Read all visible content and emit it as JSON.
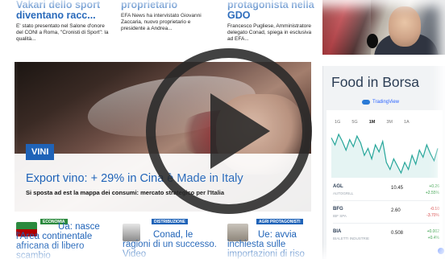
{
  "top_stories": [
    {
      "title": "Vakari dello sport diventano racc...",
      "subtitle": "E' stato presentato nel Salone d'onore del CONI a Roma, \"Cronisti di Sport\": la qualità..."
    },
    {
      "title": "proprietario",
      "subtitle": "EFA News ha intervistato Giovanni Zaccaria, nuovo proprietario e presidente a Andrea..."
    },
    {
      "title": "protagonista nella GDO",
      "subtitle": "Francesco Pugliese, Amministratore delegato Conad, spiega in esclusiva ad EFA..."
    }
  ],
  "hero": {
    "tag": "VINI",
    "headline": "Export vino: + 29% in Cina è Made in Italy",
    "dek": "Si sposta ad est la mappa dei consumi: mercato strategico per l'Italia"
  },
  "bottom_stories": [
    {
      "badge": "ECONOMIA",
      "title": "Ua: nasce l'Area continentale africana di libero scambio"
    },
    {
      "badge": "DISTRIBUZIONE",
      "title": "Conad, le ragioni di un successo. Video"
    },
    {
      "badge": "AGRI PROTAGONISTI",
      "title": "Ue: avvia inchiesta sulle importazioni di riso"
    }
  ],
  "widget": {
    "title": "Food in Borsa",
    "provider": "TradingView",
    "tabs": [
      "1G",
      "5G",
      "1M",
      "3M",
      "1A"
    ],
    "active_tab": "1M",
    "rows": [
      {
        "symbol": "AGL",
        "name": "AUTOGRILL",
        "price": "10.45",
        "change": "+0.26",
        "change_pct": "+2.55%",
        "direction": "up"
      },
      {
        "symbol": "BFG",
        "name": "IBF SPA",
        "price": "2.60",
        "change": "-0.10",
        "change_pct": "-3.70%",
        "direction": "down"
      },
      {
        "symbol": "BIA",
        "name": "BIALETTI INDUSTRIE",
        "price": "0.508",
        "change": "+0.002",
        "change_pct": "+0.4%",
        "direction": "up"
      }
    ],
    "sparkline": [
      62,
      58,
      64,
      60,
      55,
      61,
      57,
      63,
      59,
      52,
      56,
      50,
      58,
      54,
      60,
      48,
      44,
      50,
      46,
      42,
      48,
      44,
      52,
      47,
      55,
      51,
      58,
      53,
      49,
      56
    ],
    "line_color": "#26a69a"
  },
  "colors": {
    "accent": "#1f63b8",
    "play_overlay": "#282828"
  },
  "icons": {
    "play": "play-icon",
    "gear": "gear-icon"
  }
}
